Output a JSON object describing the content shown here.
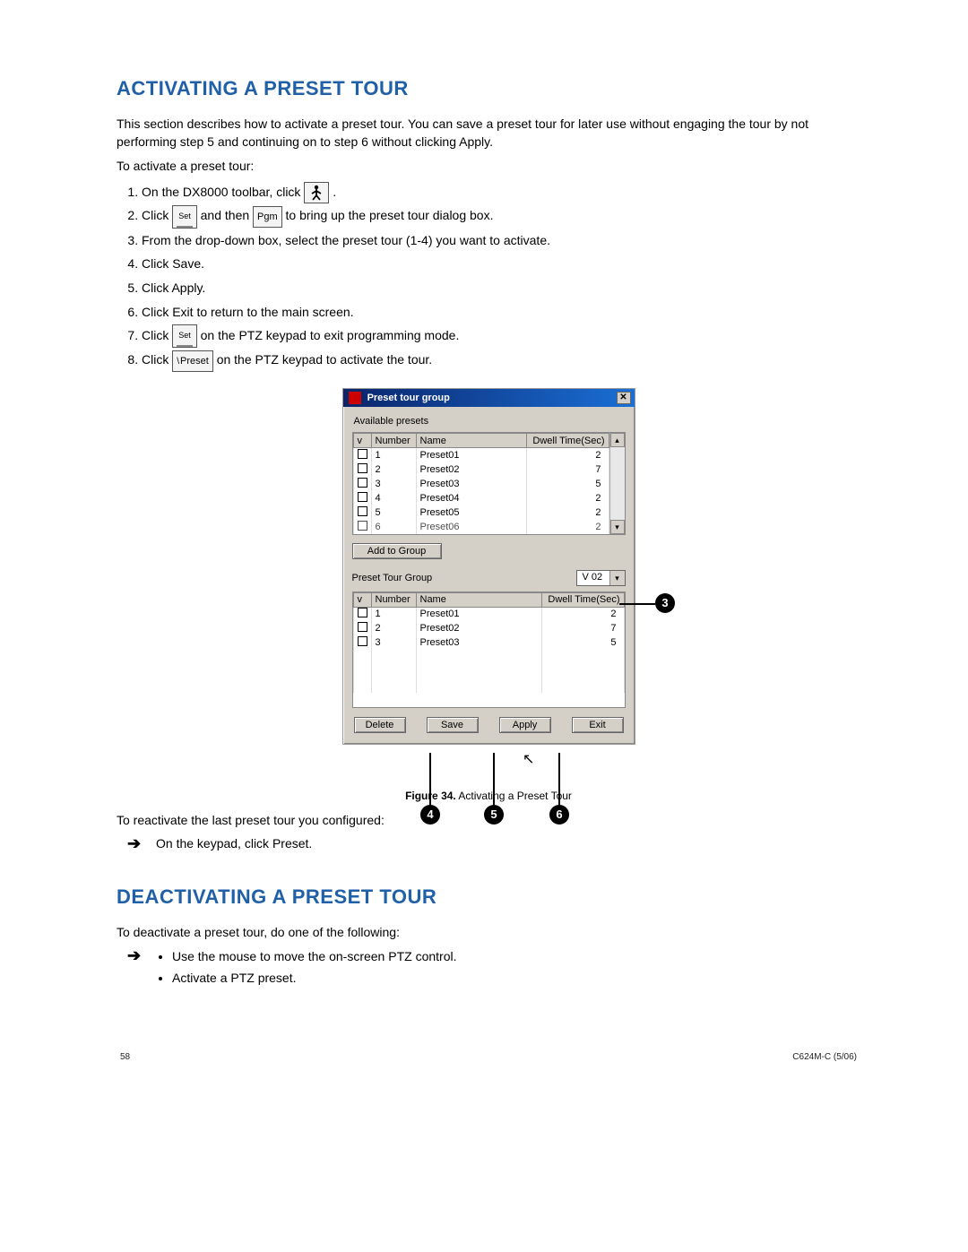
{
  "headings": {
    "activating": "ACTIVATING A PRESET TOUR",
    "deactivating": "DEACTIVATING A PRESET TOUR"
  },
  "intro": "This section describes how to activate a preset tour. You can save a preset tour for later use without engaging the tour by not performing step 5 and continuing on to step 6 without clicking Apply.",
  "to_activate": "To activate a preset tour:",
  "steps": {
    "s1a": "On the DX8000 toolbar, click ",
    "s1b": " .",
    "s2a": "Click ",
    "s2b": " and then ",
    "s2c": " to bring up the preset tour dialog box.",
    "s3": "From the drop-down box, select the preset tour (1-4) you want to activate.",
    "s4": "Click Save.",
    "s5": "Click Apply.",
    "s6": "Click Exit to return to the main screen.",
    "s7a": "Click ",
    "s7b": " on the PTZ keypad to exit programming mode.",
    "s8a": "Click ",
    "s8b": " on the PTZ keypad to activate the tour."
  },
  "icons": {
    "set": "Set",
    "pgm": "Pgm",
    "preset": "Preset"
  },
  "dialog": {
    "title": "Preset tour group",
    "avail_label": "Available presets",
    "headers": {
      "v": "v",
      "number": "Number",
      "name": "Name",
      "dwell": "Dwell Time(Sec)"
    },
    "avail_rows": [
      {
        "n": "1",
        "name": "Preset01",
        "d": "2"
      },
      {
        "n": "2",
        "name": "Preset02",
        "d": "7"
      },
      {
        "n": "3",
        "name": "Preset03",
        "d": "5"
      },
      {
        "n": "4",
        "name": "Preset04",
        "d": "2"
      },
      {
        "n": "5",
        "name": "Preset05",
        "d": "2"
      },
      {
        "n": "6",
        "name": "Preset06",
        "d": "2"
      }
    ],
    "add_to_group": "Add to Group",
    "ptg_label": "Preset Tour Group",
    "combo_value": "V 02",
    "group_rows": [
      {
        "n": "1",
        "name": "Preset01",
        "d": "2"
      },
      {
        "n": "2",
        "name": "Preset02",
        "d": "7"
      },
      {
        "n": "3",
        "name": "Preset03",
        "d": "5"
      }
    ],
    "btns": {
      "delete": "Delete",
      "save": "Save",
      "apply": "Apply",
      "exit": "Exit"
    }
  },
  "figure_caption_prefix": "Figure 34.",
  "figure_caption_text": "  Activating a Preset Tour",
  "reactivate": "To reactivate the last preset tour you configured:",
  "reactivate_bullet": "On the keypad, click Preset.",
  "deact_intro": "To deactivate a preset tour, do one of the following:",
  "deact_b1": "Use the mouse to move the on-screen PTZ control.",
  "deact_b2": "Activate a PTZ preset.",
  "callouts": {
    "c3": "3",
    "c4": "4",
    "c5": "5",
    "c6": "6"
  },
  "footer": {
    "page": "58",
    "doc": "C624M-C (5/06)"
  }
}
